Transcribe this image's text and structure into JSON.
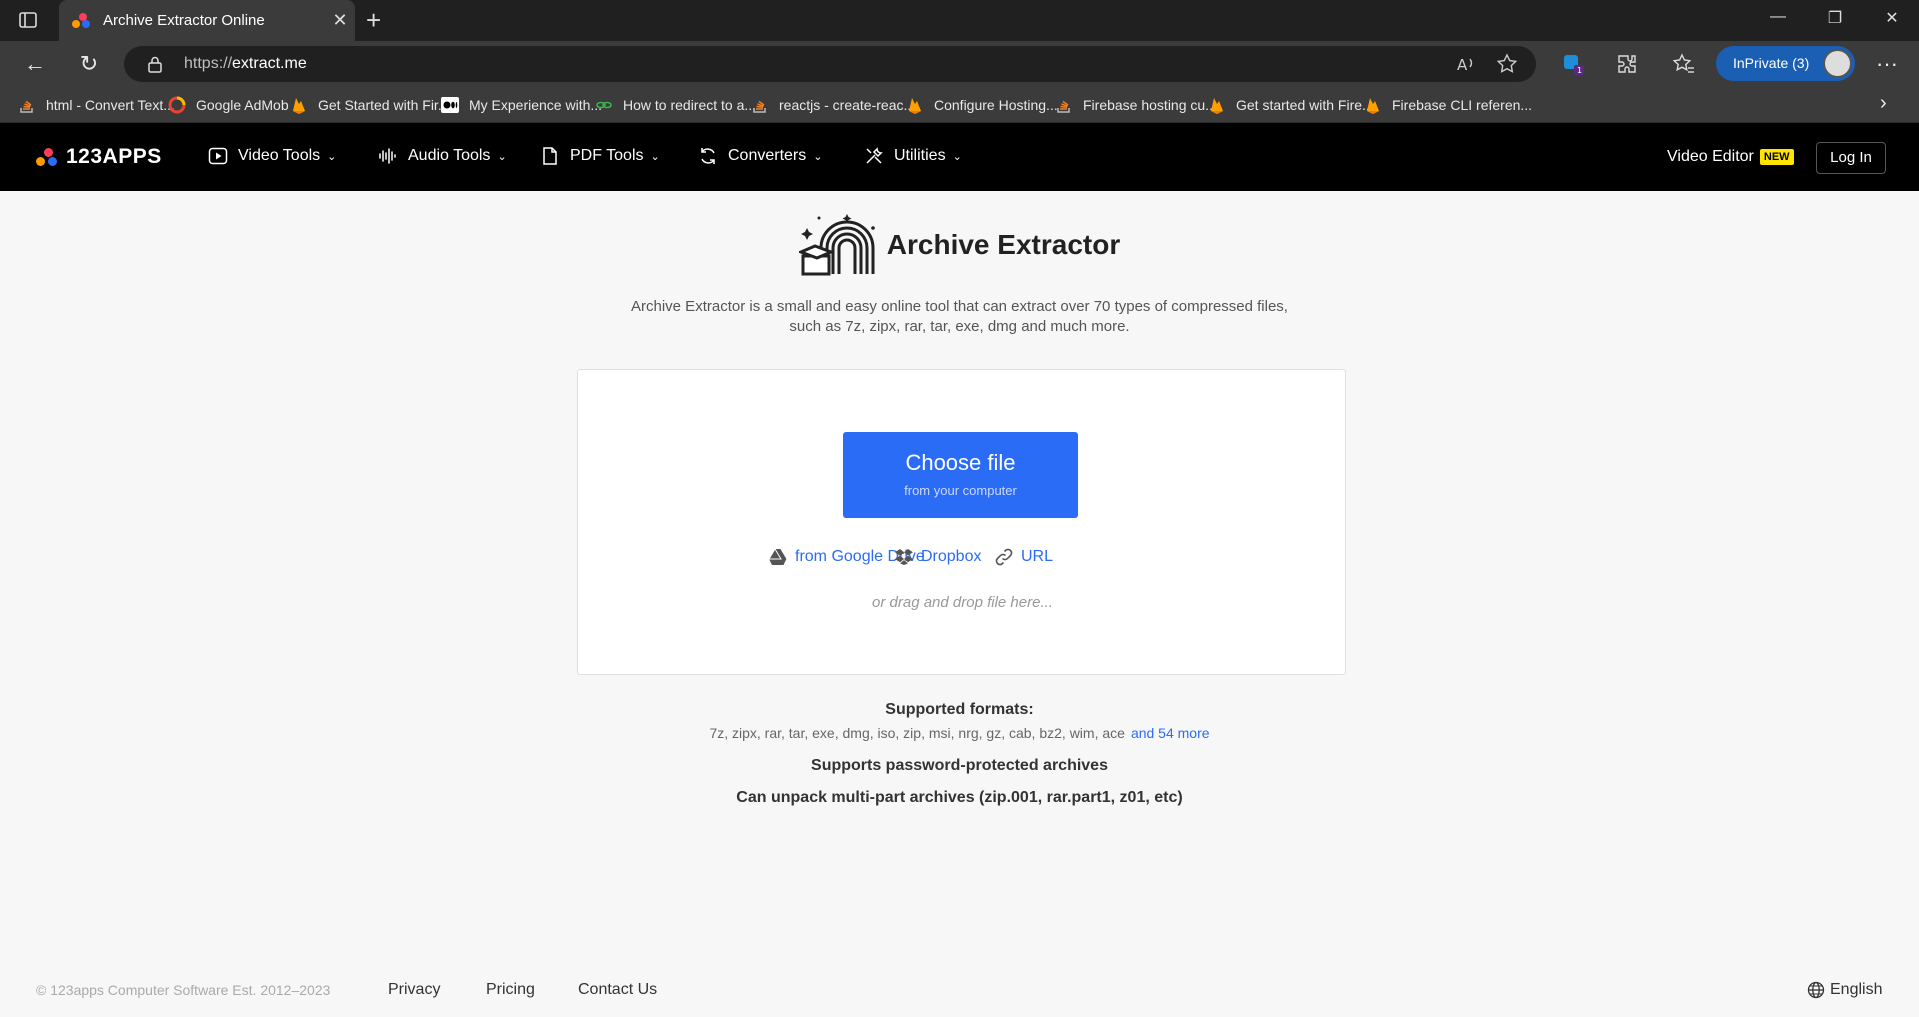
{
  "browser": {
    "tab_title": "Archive Extractor Online",
    "url_prefix": "https://",
    "url_domain": "extract.me",
    "inprivate_label": "InPrivate (3)",
    "bookmarks": [
      {
        "label": "html - Convert Text...",
        "icon": "stackoverflow-icon"
      },
      {
        "label": "Google AdMob",
        "icon": "admob-icon"
      },
      {
        "label": "Get Started with Fir...",
        "icon": "firebase-icon"
      },
      {
        "label": "My Experience with...",
        "icon": "medium-icon"
      },
      {
        "label": "How to redirect to a...",
        "icon": "link-icon"
      },
      {
        "label": "reactjs - create-reac...",
        "icon": "stackoverflow-icon"
      },
      {
        "label": "Configure Hosting...",
        "icon": "firebase-icon"
      },
      {
        "label": "Firebase hosting cu...",
        "icon": "stackoverflow-icon"
      },
      {
        "label": "Get started with Fire...",
        "icon": "firebase-icon"
      },
      {
        "label": "Firebase CLI referen...",
        "icon": "firebase-icon"
      }
    ]
  },
  "site": {
    "logo_text": "123APPS",
    "menu": [
      {
        "label": "Video Tools",
        "icon": "video-icon"
      },
      {
        "label": "Audio Tools",
        "icon": "audio-icon"
      },
      {
        "label": "PDF Tools",
        "icon": "pdf-icon"
      },
      {
        "label": "Converters",
        "icon": "converters-icon"
      },
      {
        "label": "Utilities",
        "icon": "utilities-icon"
      }
    ],
    "video_editor_label": "Video Editor",
    "new_badge": "NEW",
    "login_label": "Log In"
  },
  "main": {
    "title": "Archive Extractor",
    "description_line1": "Archive Extractor is a small and easy online tool that can extract over 70 types of compressed files,",
    "description_line2": "such as 7z, zipx, rar, tar, exe, dmg and much more.",
    "choose_file": "Choose file",
    "choose_file_sub": "from your computer",
    "sources": {
      "google_drive": "from Google Drive",
      "dropbox": "Dropbox",
      "url": "URL"
    },
    "drag_drop": "or drag and drop file here...",
    "formats_title": "Supported formats:",
    "formats_list": "7z, zipx, rar, tar, exe, dmg, iso, zip, msi, nrg, gz, cab, bz2, wim, ace",
    "formats_more": "and 54 more",
    "feature_password": "Supports password-protected archives",
    "feature_multipart": "Can unpack multi-part archives (zip.001, rar.part1, z01, etc)"
  },
  "footer": {
    "copyright": "© 123apps Computer Software Est. 2012–2023",
    "privacy": "Privacy",
    "pricing": "Pricing",
    "contact": "Contact Us",
    "language": "English"
  },
  "colors": {
    "accent_blue": "#2b6cf6",
    "new_badge": "#ffe400",
    "header_bg": "#000000"
  }
}
